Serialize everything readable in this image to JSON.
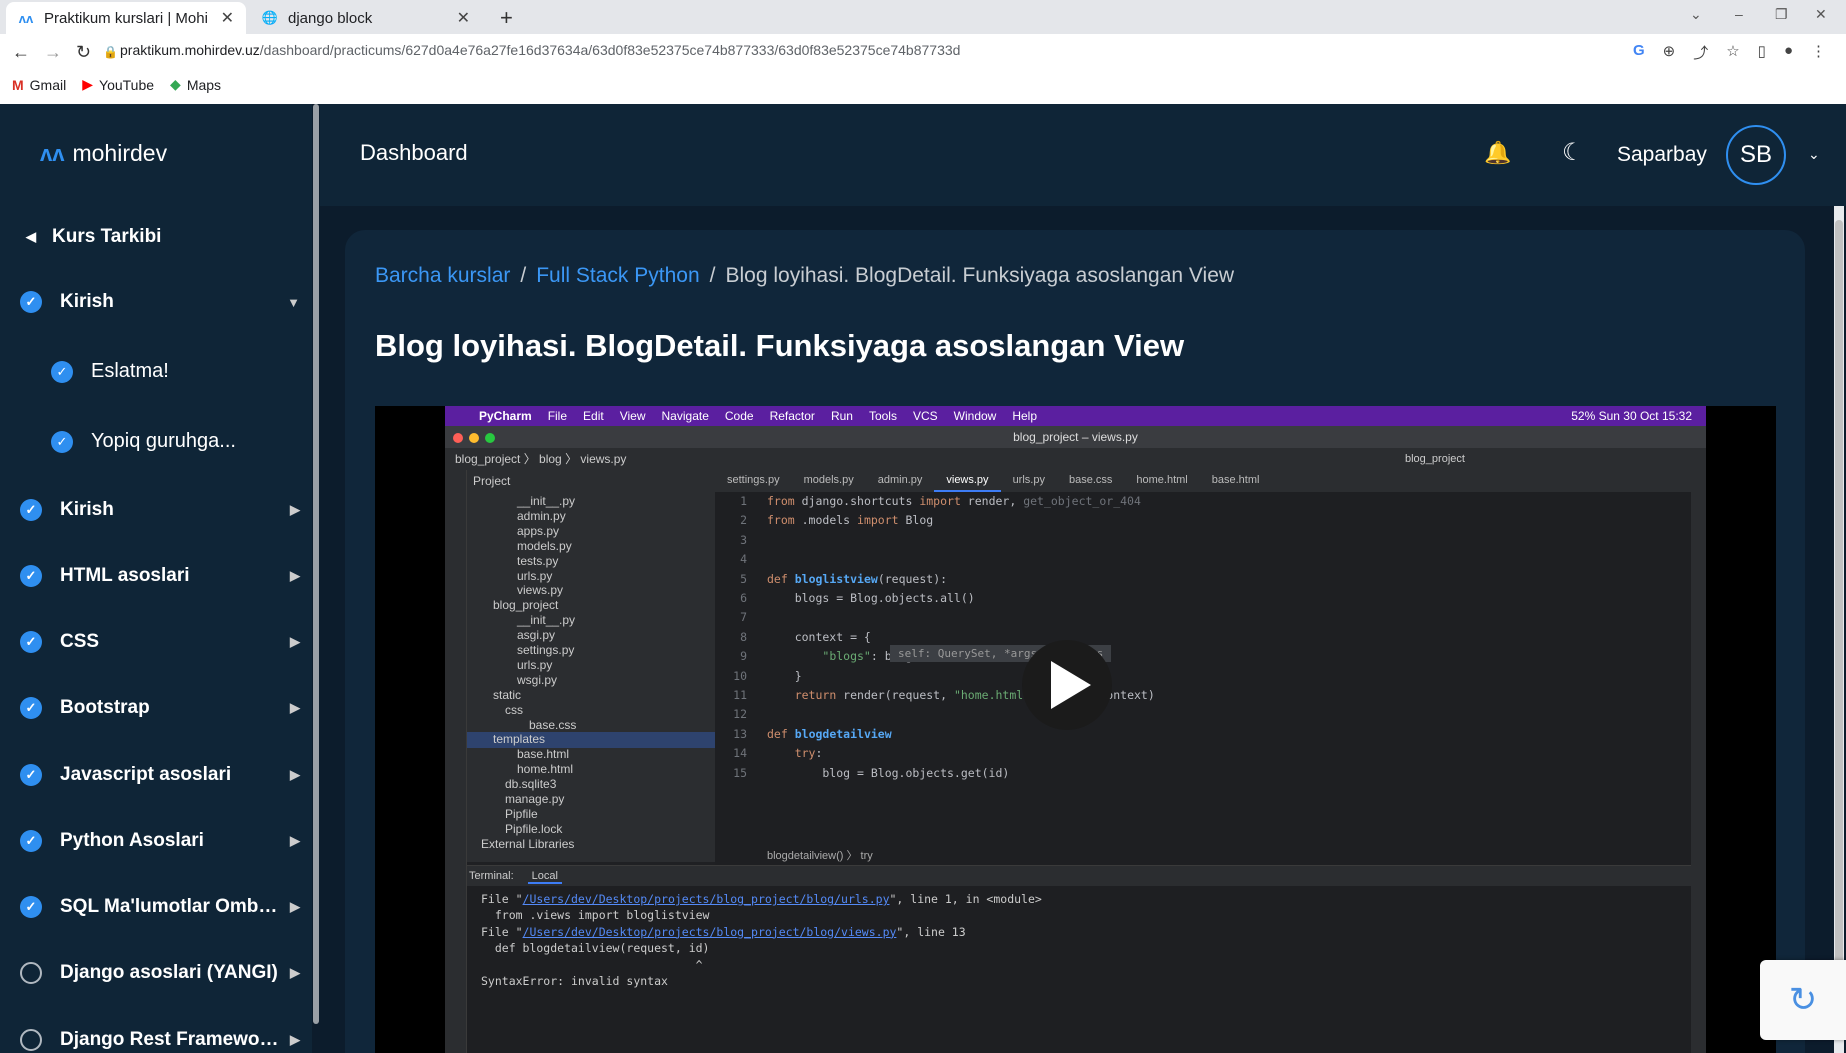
{
  "browser": {
    "tabs": [
      {
        "title": "Praktikum kurslari | Mohi",
        "active": true
      },
      {
        "title": "django block",
        "active": false
      }
    ],
    "url_host": "praktikum.mohirdev.uz",
    "url_path": "/dashboard/practicums/627d0a4e76a27fe16d37634a/63d0f83e52375ce74b877333/63d0f83e52375ce74b87733d",
    "bookmarks": [
      "Gmail",
      "YouTube",
      "Maps"
    ]
  },
  "sidebar": {
    "logo_text": "mohirdev",
    "back_label": "Kurs Tarkibi",
    "items": [
      {
        "label": "Kirish",
        "done": true,
        "expanded": true,
        "sub": false
      },
      {
        "label": "Eslatma!",
        "done": true,
        "sub": true
      },
      {
        "label": "Yopiq guruhga...",
        "done": true,
        "sub": true
      },
      {
        "label": "Kirish",
        "done": true,
        "sub": false
      },
      {
        "label": "HTML asoslari",
        "done": true,
        "sub": false
      },
      {
        "label": "CSS",
        "done": true,
        "sub": false
      },
      {
        "label": "Bootstrap",
        "done": true,
        "sub": false
      },
      {
        "label": "Javascript asoslari",
        "done": true,
        "sub": false
      },
      {
        "label": "Python Asoslari",
        "done": true,
        "sub": false
      },
      {
        "label": "SQL Ma'lumotlar Ombori...",
        "done": true,
        "sub": false
      },
      {
        "label": "Django asoslari (YANGI)",
        "done": false,
        "sub": false
      },
      {
        "label": "Django Rest Framework...",
        "done": false,
        "sub": false
      }
    ]
  },
  "header": {
    "title": "Dashboard",
    "user_name": "Saparbay",
    "avatar_initials": "SB"
  },
  "main": {
    "breadcrumb": [
      "Barcha kurslar",
      "Full Stack Python",
      "Blog loyihasi. BlogDetail. Funksiyaga asoslangan View"
    ],
    "page_title": "Blog loyihasi. BlogDetail. Funksiyaga asoslangan View"
  },
  "video": {
    "mac_menu": [
      "PyCharm",
      "File",
      "Edit",
      "View",
      "Navigate",
      "Code",
      "Refactor",
      "Run",
      "Tools",
      "VCS",
      "Window",
      "Help"
    ],
    "mac_status": "52%   Sun 30 Oct  15:32",
    "window_title": "blog_project – views.py",
    "nav_path": "blog_project 〉 blog 〉 views.py",
    "project_selector": "blog_project",
    "editor_tabs": [
      "settings.py",
      "models.py",
      "admin.py",
      "views.py",
      "urls.py",
      "base.css",
      "home.html",
      "base.html"
    ],
    "project_label": "Project",
    "tree": [
      {
        "t": "__init__.py",
        "indent": 3
      },
      {
        "t": "admin.py",
        "indent": 3
      },
      {
        "t": "apps.py",
        "indent": 3
      },
      {
        "t": "models.py",
        "indent": 3
      },
      {
        "t": "tests.py",
        "indent": 3
      },
      {
        "t": "urls.py",
        "indent": 3
      },
      {
        "t": "views.py",
        "indent": 3
      },
      {
        "t": "blog_project",
        "indent": 1
      },
      {
        "t": "__init__.py",
        "indent": 3
      },
      {
        "t": "asgi.py",
        "indent": 3
      },
      {
        "t": "settings.py",
        "indent": 3
      },
      {
        "t": "urls.py",
        "indent": 3
      },
      {
        "t": "wsgi.py",
        "indent": 3
      },
      {
        "t": "static",
        "indent": 1
      },
      {
        "t": "css",
        "indent": 2
      },
      {
        "t": "base.css",
        "indent": 4
      },
      {
        "t": "templates",
        "indent": 1
      },
      {
        "t": "base.html",
        "indent": 3
      },
      {
        "t": "home.html",
        "indent": 3
      },
      {
        "t": "db.sqlite3",
        "indent": 2
      },
      {
        "t": "manage.py",
        "indent": 2
      },
      {
        "t": "Pipfile",
        "indent": 2
      },
      {
        "t": "Pipfile.lock",
        "indent": 2
      },
      {
        "t": "External Libraries",
        "indent": 0
      }
    ],
    "code_hint": "self: QuerySet, *args, **kwargs",
    "editor_breadcrumb": "blogdetailview()  〉  try",
    "terminal_label": "Terminal:",
    "terminal_tab": "Local",
    "terminal_lines": [
      {
        "pre": "File \"",
        "link": "/Users/dev/Desktop/projects/blog_project/blog/urls.py",
        "post": "\", line 1, in <module>"
      },
      {
        "pre": "  from .views import bloglistview",
        "link": "",
        "post": ""
      },
      {
        "pre": "File \"",
        "link": "/Users/dev/Desktop/projects/blog_project/blog/views.py",
        "post": "\", line 13"
      },
      {
        "pre": "  def blogdetailview(request, id)",
        "link": "",
        "post": ""
      },
      {
        "pre": "                               ^",
        "link": "",
        "post": ""
      },
      {
        "pre": "SyntaxError: invalid syntax",
        "link": "",
        "post": ""
      }
    ]
  },
  "colors": {
    "accent": "#2f8ff0",
    "sidebar_bg": "#0f2537",
    "page_bg": "#0c1c2c"
  }
}
